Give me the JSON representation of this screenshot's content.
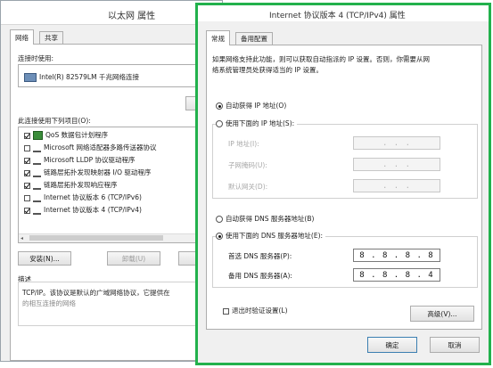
{
  "ethernet": {
    "title": "以太网 属性",
    "tabs": [
      "网络",
      "共享"
    ],
    "connect_using_label": "连接时使用:",
    "adapter_name": "Intel(R) 82579LM 千兆网络连接",
    "items_label": "此连接使用下列项目(O):",
    "items": [
      {
        "label": "QoS 数据包计划程序",
        "checked": true
      },
      {
        "label": "Microsoft 网络适配器多路传送器协议",
        "checked": false
      },
      {
        "label": "Microsoft LLDP 协议驱动程序",
        "checked": true
      },
      {
        "label": "链路层拓扑发现映射器 I/O 驱动程序",
        "checked": true
      },
      {
        "label": "链路层拓扑发现响应程序",
        "checked": true
      },
      {
        "label": "Internet 协议版本 6 (TCP/IPv6)",
        "checked": false
      },
      {
        "label": "Internet 协议版本 4 (TCP/IPv4)",
        "checked": true
      }
    ],
    "install_button": "安装(N)...",
    "uninstall_button": "卸载(U)",
    "description_label": "描述",
    "description_text": "TCP/IP。该协议是默认的广域网络协议，它提供在",
    "description_text2": "的相互连接的网络"
  },
  "ipv4": {
    "title": "Internet 协议版本 4 (TCP/IPv4) 属性",
    "tabs": [
      "常规",
      "备用配置"
    ],
    "intro_line1": "如果网络支持此功能，则可以获取自动指派的 IP 设置。否则，你需要从网",
    "intro_line2": "络系统管理员处获得适当的 IP 设置。",
    "auto_ip_label": "自动获得 IP 地址(O)",
    "manual_ip_label": "使用下面的 IP 地址(S):",
    "ip_address_label": "IP 地址(I):",
    "subnet_label": "子网掩码(U):",
    "gateway_label": "默认网关(D):",
    "empty_ip": ".   .   .",
    "auto_dns_label": "自动获得 DNS 服务器地址(B)",
    "manual_dns_label": "使用下面的 DNS 服务器地址(E):",
    "preferred_dns_label": "首选 DNS 服务器(P):",
    "preferred_dns_value": "8 . 8 . 8 . 8",
    "alternate_dns_label": "备用 DNS 服务器(A):",
    "alternate_dns_value": "8 . 8 . 8 . 4",
    "validate_label": "退出时验证设置(L)",
    "advanced_button": "高级(V)...",
    "ok_button": "确定",
    "cancel_button": "取消"
  },
  "colors": {
    "highlight_border": "#22b14c"
  }
}
